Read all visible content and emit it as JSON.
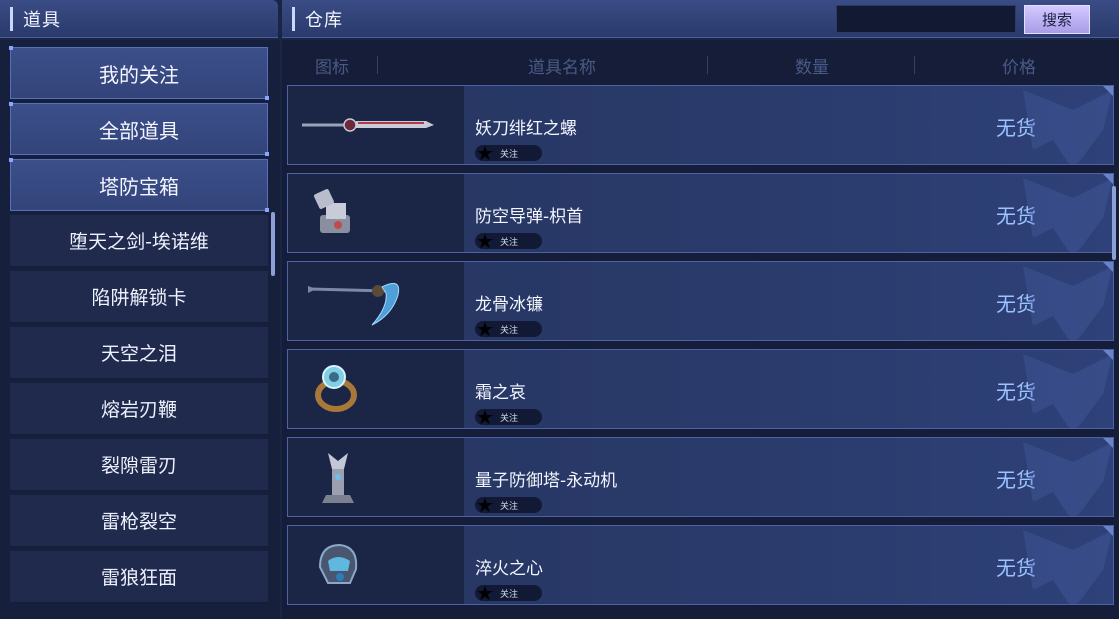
{
  "left_panel": {
    "title": "道具"
  },
  "right_panel": {
    "title": "仓库"
  },
  "search": {
    "value": "",
    "placeholder": "",
    "button_label": "搜索"
  },
  "categories": [
    {
      "label": "我的关注"
    },
    {
      "label": "全部道具"
    },
    {
      "label": "塔防宝箱"
    }
  ],
  "subcategories": [
    {
      "label": "堕天之剑-埃诺维"
    },
    {
      "label": "陷阱解锁卡"
    },
    {
      "label": "天空之泪"
    },
    {
      "label": "熔岩刃鞭"
    },
    {
      "label": "裂隙雷刃"
    },
    {
      "label": "雷枪裂空"
    },
    {
      "label": "雷狼狂面"
    }
  ],
  "table": {
    "columns": [
      "图标",
      "道具名称",
      "数量",
      "价格"
    ],
    "rows": [
      {
        "name": "妖刀绯红之螺",
        "icon": "sword-icon",
        "follow_label": "关注",
        "price": "无货"
      },
      {
        "name": "防空导弹-枳首",
        "icon": "turret-icon",
        "follow_label": "关注",
        "price": "无货"
      },
      {
        "name": "龙骨冰镰",
        "icon": "scythe-icon",
        "follow_label": "关注",
        "price": "无货"
      },
      {
        "name": "霜之哀",
        "icon": "ring-icon",
        "follow_label": "关注",
        "price": "无货"
      },
      {
        "name": "量子防御塔-永动机",
        "icon": "tower-icon",
        "follow_label": "关注",
        "price": "无货"
      },
      {
        "name": "淬火之心",
        "icon": "helmet-icon",
        "follow_label": "关注",
        "price": "无货"
      }
    ]
  },
  "colors": {
    "background": "#1a2546",
    "category_active": "#3c4f8a",
    "price_text": "#9cc3ff",
    "search_button": "#d3c9ff"
  }
}
